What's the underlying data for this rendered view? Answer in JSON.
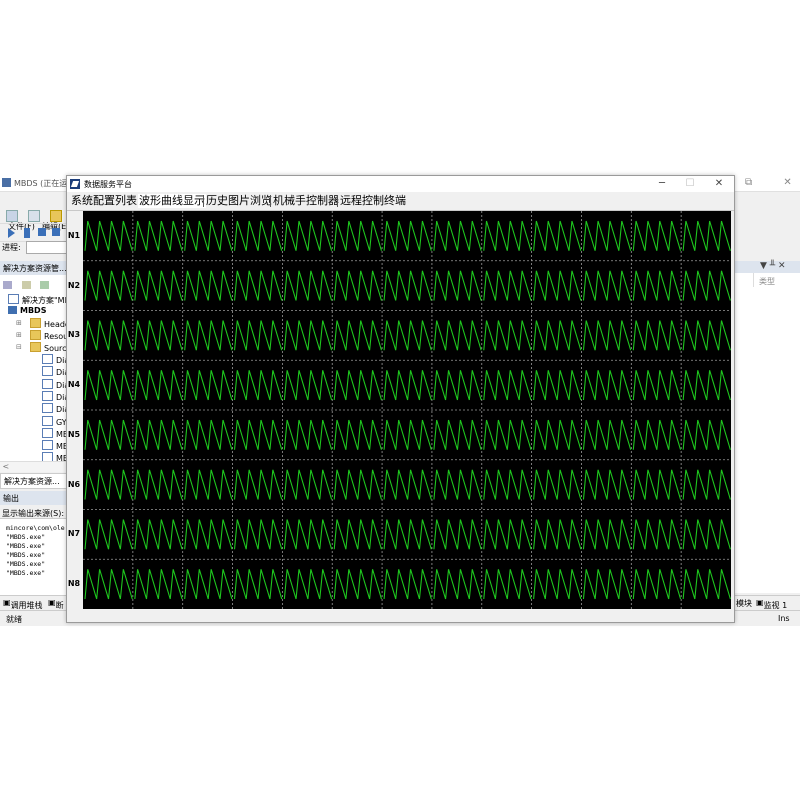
{
  "ide": {
    "title": "MBDS (正在运行",
    "menu": [
      "文件(F)",
      "编辑(E)"
    ],
    "progress_label": "进程:",
    "solution_explorer_title": "解决方案资源管...",
    "tree": {
      "solution": "解决方案\"MB",
      "project": "MBDS",
      "folders": [
        "Heade",
        "Resou",
        "Sourc"
      ],
      "files": [
        "Dia",
        "Dia",
        "Dia",
        "Dia",
        "Dia",
        "GY",
        "MB",
        "MB",
        "MB"
      ]
    },
    "solution_tab": "解决方案资源...",
    "output_title": "输出",
    "output_source_label": "显示输出来源(S):",
    "output_lines": [
      "mincore\\com\\ole",
      "\"MBDS.exe\"",
      "\"MBDS.exe\"",
      "\"MBDS.exe\"",
      "\"MBDS.exe\"",
      "\"MBDS.exe\""
    ],
    "bottom_tabs": [
      "调用堆栈",
      "断",
      "模块",
      "监视 1"
    ],
    "status_left": "就绪",
    "status_right": "Ins",
    "right_panel_col": "类型",
    "right_panel_icons": "▼ ╨ ✕"
  },
  "app": {
    "title": "数据服务平台",
    "tabs": [
      "系统配置列表",
      "波形曲线显示",
      "历史图片浏览",
      "机械手控制器",
      "远程控制终端"
    ],
    "active_tab_index": 1,
    "channels": [
      "N1",
      "N2",
      "N3",
      "N4",
      "N5",
      "N6",
      "N7",
      "N8"
    ],
    "grid_columns": 13,
    "wave_color": "#1ec81e",
    "grid_color": "#9a9a9a",
    "scope_background": "#000000",
    "teeth_per_division": 4
  }
}
